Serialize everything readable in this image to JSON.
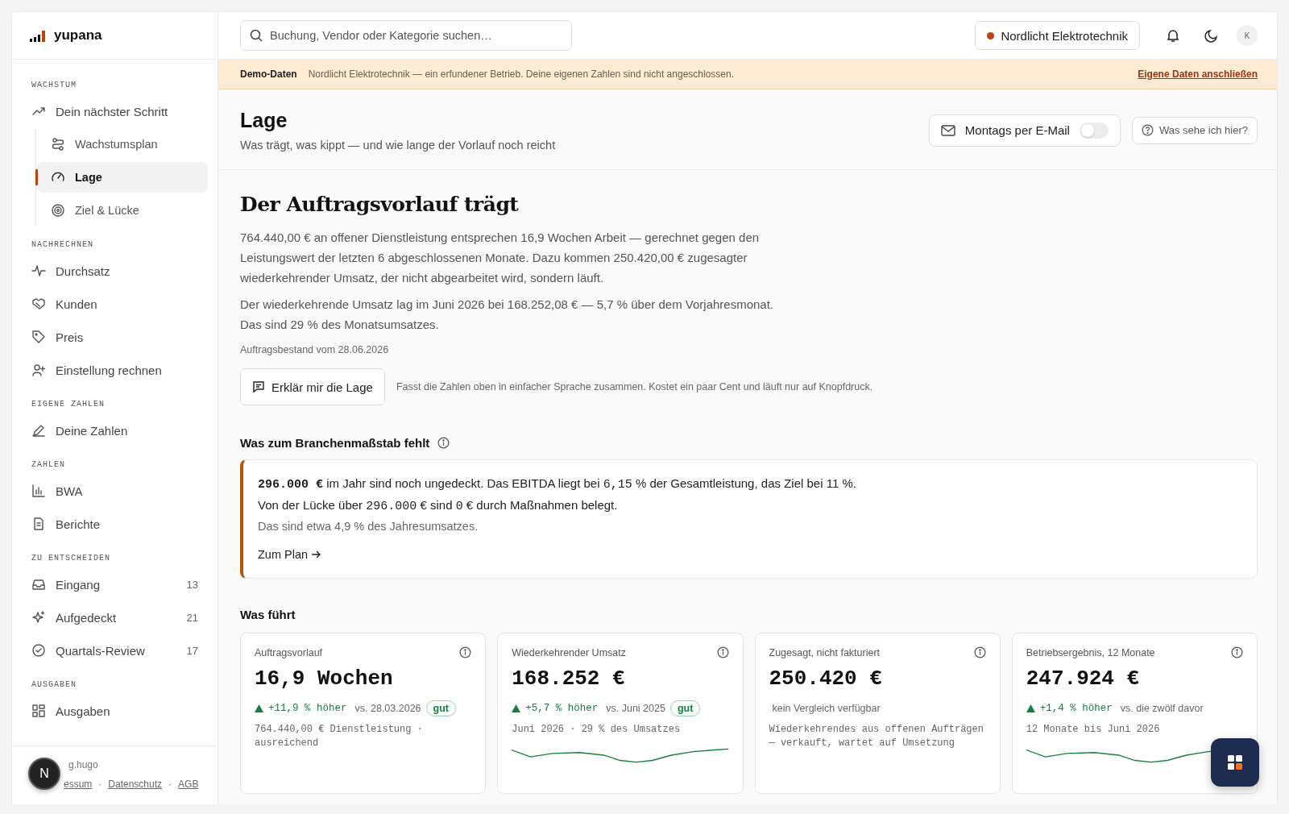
{
  "brand": {
    "name": "yupana"
  },
  "sidebar": {
    "sections": [
      {
        "label": "WACHSTUM",
        "items": [
          {
            "label": "Dein nächster Schritt",
            "selected": false,
            "children": [
              {
                "label": "Wachstumsplan",
                "selected": false
              },
              {
                "label": "Lage",
                "selected": true
              },
              {
                "label": "Ziel & Lücke",
                "selected": false
              }
            ]
          }
        ]
      },
      {
        "label": "NACHRECHNEN",
        "items": [
          {
            "label": "Durchsatz",
            "selected": false
          },
          {
            "label": "Kunden",
            "selected": false
          },
          {
            "label": "Preis",
            "selected": false
          },
          {
            "label": "Einstellung rechnen",
            "selected": false
          }
        ]
      },
      {
        "label": "EIGENE ZAHLEN",
        "items": [
          {
            "label": "Deine Zahlen",
            "selected": false
          }
        ]
      },
      {
        "label": "ZAHLEN",
        "items": [
          {
            "label": "BWA",
            "selected": false
          },
          {
            "label": "Berichte",
            "selected": false
          }
        ]
      },
      {
        "label": "ZU ENTSCHEIDEN",
        "items": [
          {
            "label": "Eingang",
            "count": "13",
            "selected": false
          },
          {
            "label": "Aufgedeckt",
            "count": "21",
            "selected": false
          },
          {
            "label": "Quartals-Review",
            "count": "17",
            "selected": false
          }
        ]
      },
      {
        "label": "AUSGABEN",
        "items": [
          {
            "label": "Ausgaben",
            "selected": false
          }
        ]
      }
    ],
    "footer": {
      "credit": "g.hugo",
      "links": [
        "essum",
        "Datenschutz",
        "AGB"
      ],
      "separator": "·"
    },
    "avatar_badge": "N"
  },
  "header": {
    "search": {
      "placeholder": "Buchung, Vendor oder Kategorie suchen…"
    },
    "company": {
      "name": "Nordlicht Elektrotechnik",
      "color": "#c2410c"
    },
    "user_initial": "K"
  },
  "banner": {
    "label": "Demo-Daten",
    "text": "Nordlicht Elektrotechnik — ein erfundener Betrieb. Deine eigenen Zahlen sind nicht angeschlossen.",
    "link": "Eigene Daten anschließen"
  },
  "page": {
    "title": "Lage",
    "subtitle": "Was trägt, was kippt — und wie lange der Vorlauf noch reicht",
    "email_toggle": {
      "label": "Montags per E-Mail",
      "on": false
    },
    "help_button": "Was sehe ich hier?"
  },
  "summary": {
    "heading": "Der Auftragsvorlauf trägt",
    "paragraphs": [
      "764.440,00 € an offener Dienstleistung entsprechen 16,9 Wochen Arbeit — gerechnet gegen den Leistungswert der letzten 6 abgeschlossenen Monate. Dazu kommen 250.420,00 € zugesagter wiederkehrender Umsatz, der nicht abgearbeitet wird, sondern läuft.",
      "Der wiederkehrende Umsatz lag im Juni 2026 bei 168.252,08 € — 5,7 % über dem Vorjahresmonat. Das sind 29 % des Monatsumsatzes."
    ],
    "as_of": "Auftragsbestand vom 28.06.2026",
    "explain_button": "Erklär mir die Lage",
    "explain_note": "Fasst die Zahlen oben in einfacher Sprache zusammen. Kostet ein paar Cent und läuft nur auf Knopfdruck."
  },
  "gap": {
    "heading": "Was zum Branchenmaßstab fehlt",
    "segments": [
      {
        "kind": "strong",
        "text": "296.000 €"
      },
      {
        "kind": "text",
        "text": " im Jahr sind noch ungedeckt. Das EBITDA liegt bei "
      },
      {
        "kind": "mono",
        "text": "6,15"
      },
      {
        "kind": "text",
        "text": " % der Gesamtleistung, das Ziel bei 11 %. Von der Lücke über "
      },
      {
        "kind": "mono",
        "text": "296.000"
      },
      {
        "kind": "text",
        "text": " € sind "
      },
      {
        "kind": "mono",
        "text": "0"
      },
      {
        "kind": "text",
        "text": " € durch Maßnahmen belegt."
      }
    ],
    "note": "Das sind etwa 4,9 % des Jahresumsatzes.",
    "link": "Zum Plan"
  },
  "leaders": {
    "heading": "Was führt",
    "cards": [
      {
        "title": "Auftragsvorlauf",
        "value": "16,9 Wochen",
        "delta": "+11,9 % höher",
        "comparison": "vs. 28.03.2026",
        "badge": "gut",
        "note": "764.440,00 € Dienstleistung · ausreichend",
        "sparkline": false
      },
      {
        "title": "Wiederkehrender Umsatz",
        "value": "168.252 €",
        "delta": "+5,7 % höher",
        "comparison": "vs. Juni 2025",
        "badge": "gut",
        "note": "Juni 2026 · 29 % des Umsatzes",
        "sparkline": true
      },
      {
        "title": "Zugesagt, nicht fakturiert",
        "value": "250.420 €",
        "comparison": "kein Vergleich verfügbar",
        "note": "Wiederkehrendes aus offenen Aufträgen — verkauft, wartet auf Umsetzung",
        "sparkline": false
      },
      {
        "title": "Betriebsergebnis, 12 Monate",
        "value": "247.924 €",
        "delta": "+1,4 % höher",
        "comparison": "vs. die zwölf davor",
        "note": "12 Monate bis Juni 2026",
        "sparkline": true
      }
    ]
  }
}
